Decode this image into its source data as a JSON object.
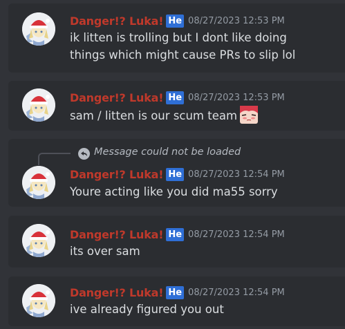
{
  "messages": [
    {
      "username": "Danger!? Luka!",
      "badge": "He",
      "timestamp": "08/27/2023 12:53 PM",
      "lines": [
        "ik litten is trolling but I dont like doing",
        "things which might cause PRs to slip lol"
      ]
    },
    {
      "username": "Danger!? Luka!",
      "badge": "He",
      "timestamp": "08/27/2023 12:53 PM",
      "lines": [
        "sam / litten is our scum team"
      ],
      "emoji": "flushed-anime-girl-emoji"
    },
    {
      "reply_text": "Message could not be loaded",
      "username": "Danger!? Luka!",
      "badge": "He",
      "timestamp": "08/27/2023 12:54 PM",
      "lines": [
        "Youre acting like you did ma55 sorry"
      ]
    },
    {
      "username": "Danger!? Luka!",
      "badge": "He",
      "timestamp": "08/27/2023 12:54 PM",
      "lines": [
        "its over sam"
      ]
    },
    {
      "username": "Danger!? Luka!",
      "badge": "He",
      "timestamp": "08/27/2023 12:54 PM",
      "lines": [
        "ive already figured you out"
      ]
    }
  ],
  "colors": {
    "background": "#313338",
    "message_bg": "#2b2d31",
    "username": "#c0392b",
    "badge": "#2f6fd6",
    "text": "#dbdee1"
  }
}
